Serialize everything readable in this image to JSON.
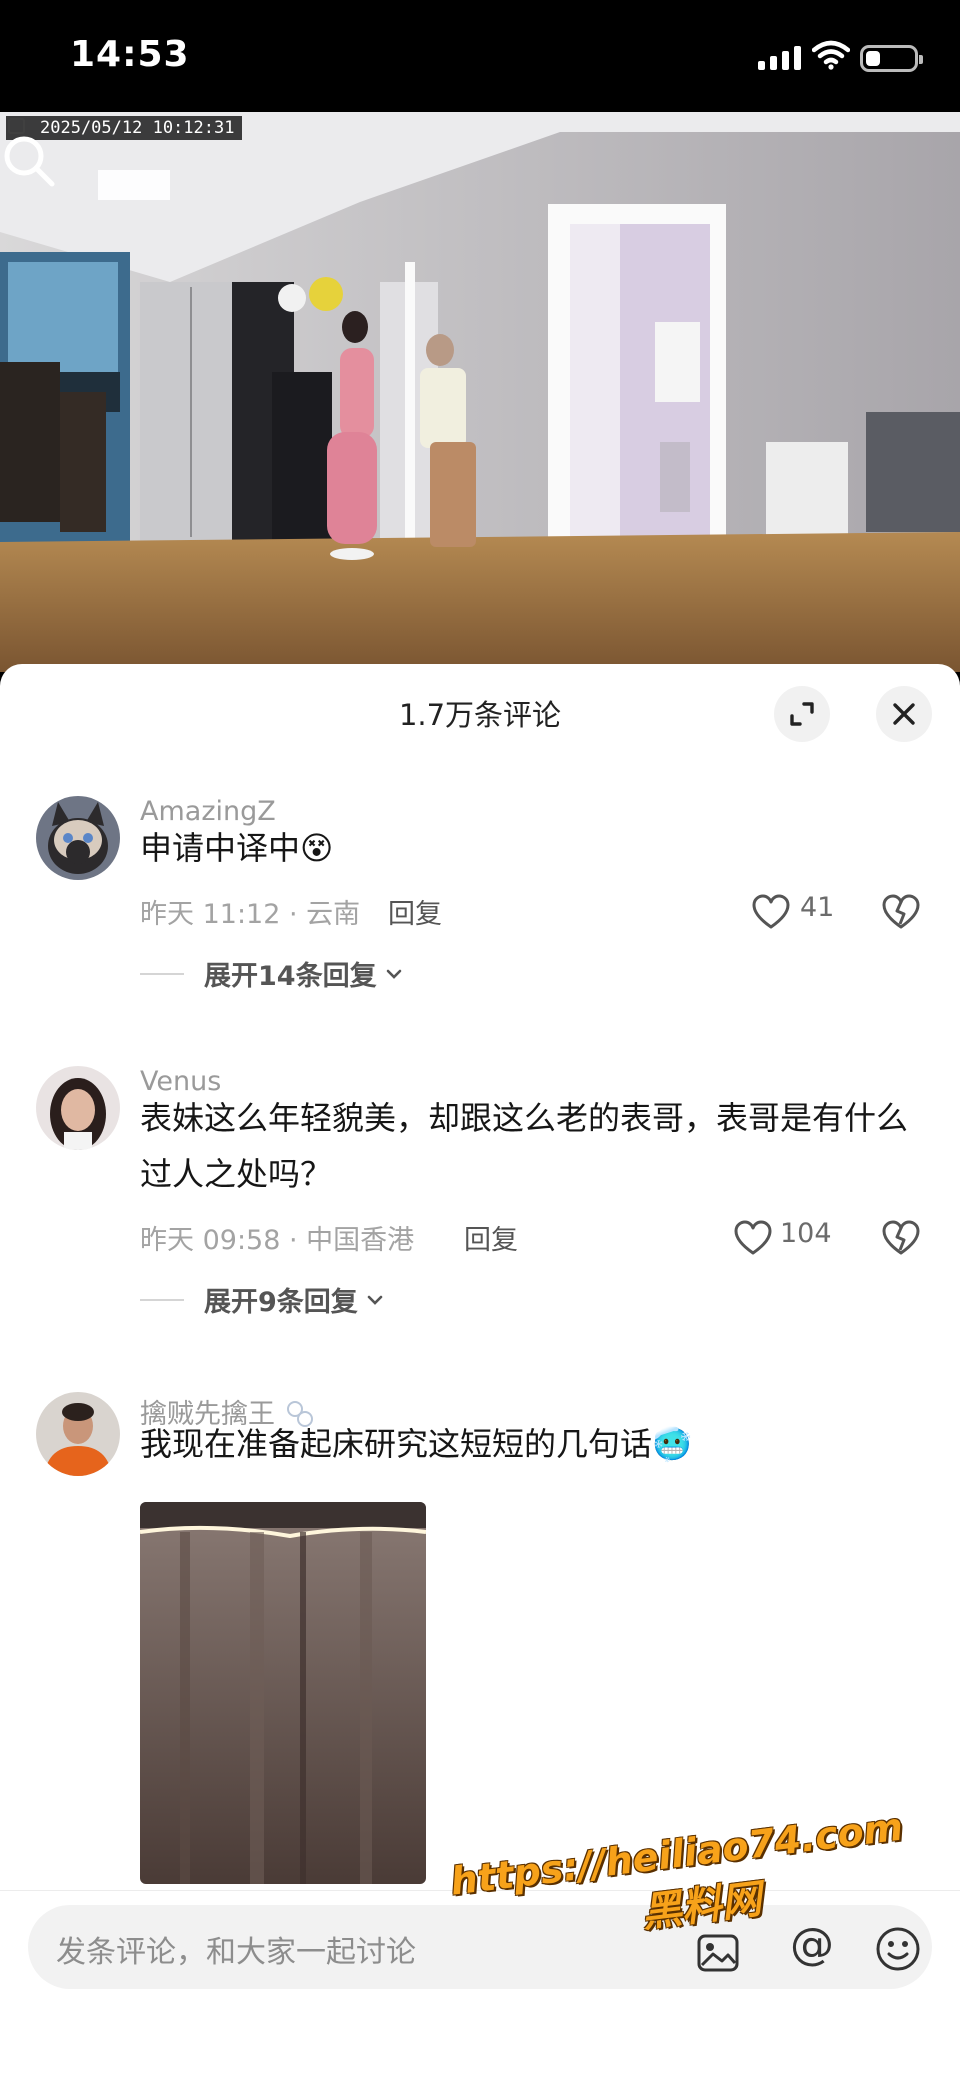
{
  "status_bar": {
    "time": "14:53",
    "battery_level": 0.3
  },
  "video": {
    "cam_timestamp": "2025/05/12 10:12:31"
  },
  "sheet": {
    "title": "1.7万条评论"
  },
  "comments": [
    {
      "username": "AmazingZ",
      "text": "申请中译中",
      "emoji": "😵",
      "meta": "昨天 11:12 · 云南",
      "reply_label": "回复",
      "likes": "41",
      "expand_label": "展开14条回复"
    },
    {
      "username": "Venus",
      "text": "表妹这么年轻貌美，却跟这么老的表哥，表哥是有什么过人之处吗？",
      "meta": "昨天 09:58 · 中国香港",
      "reply_label": "回复",
      "likes": "104",
      "expand_label": "展开9条回复"
    },
    {
      "username": "擒贼先擒王",
      "text": "我现在准备起床研究这短短的几句话",
      "emoji": "🥶"
    }
  ],
  "input": {
    "placeholder": "发条评论，和大家一起讨论",
    "at_label": "@"
  },
  "watermark": {
    "url": "https://heiliao74.com",
    "name": "黑料网"
  },
  "colors": {
    "sheet_bg": "#ffffff",
    "muted_text": "#a3a3a3",
    "watermark": "#f7a21a"
  },
  "icons": [
    "search-icon",
    "expand-icon",
    "close-icon",
    "heart-icon",
    "broken-heart-icon",
    "chevron-down-icon",
    "image-icon",
    "emoji-icon"
  ]
}
